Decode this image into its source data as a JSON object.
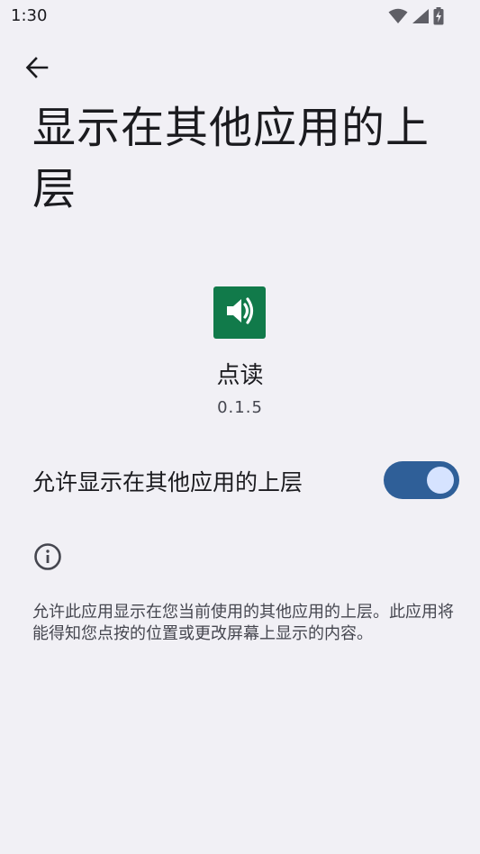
{
  "status_bar": {
    "time": "1:30",
    "icons": [
      "wifi-icon",
      "signal-icon",
      "battery-charging-icon"
    ]
  },
  "header": {
    "back_icon": "arrow-left-icon",
    "title": "显示在其他应用的上层"
  },
  "app": {
    "icon": "speaker-icon",
    "icon_color": "#117a4a",
    "name": "点读",
    "version": "0.1.5"
  },
  "permission": {
    "label": "允许显示在其他应用的上层",
    "enabled": true,
    "switch_track_color": "#2f5f98",
    "switch_thumb_color": "#d6e3ff"
  },
  "info": {
    "icon": "info-icon",
    "text": "允许此应用显示在您当前使用的其他应用的上层。此应用将能得知您点按的位置或更改屏幕上显示的内容。"
  }
}
